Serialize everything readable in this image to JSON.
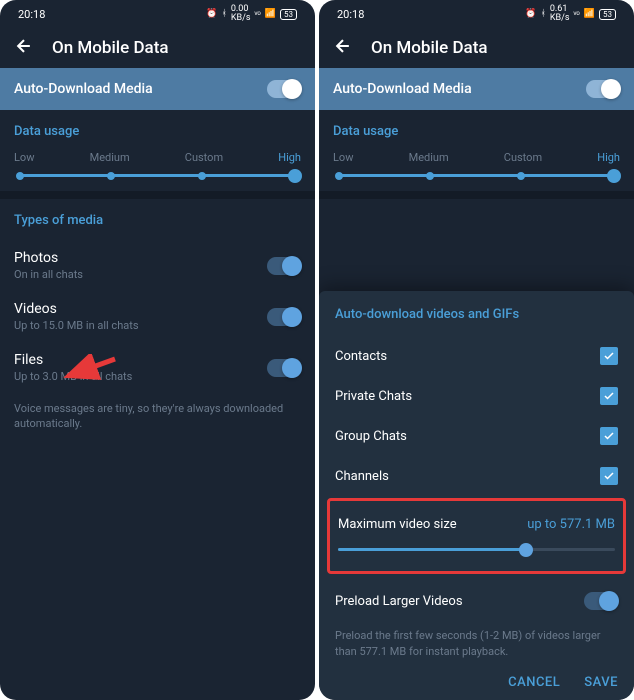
{
  "status": {
    "time": "20:18",
    "battery": "53"
  },
  "header": {
    "title": "On Mobile Data"
  },
  "banner": {
    "title": "Auto-Download Media"
  },
  "dataUsage": {
    "title": "Data usage",
    "labels": [
      "Low",
      "Medium",
      "Custom",
      "High"
    ]
  },
  "media": {
    "title": "Types of media",
    "photos": {
      "title": "Photos",
      "sub": "On in all chats"
    },
    "videos": {
      "title": "Videos",
      "sub": "Up to 15.0 MB in all chats"
    },
    "files": {
      "title": "Files",
      "sub": "Up to 3.0 MB in all chats"
    },
    "note": "Voice messages are tiny, so they're always downloaded automatically."
  },
  "dialog": {
    "title": "Auto-download videos and GIFs",
    "items": [
      "Contacts",
      "Private Chats",
      "Group Chats",
      "Channels"
    ],
    "maxLabel": "Maximum video size",
    "maxValue": "up to 577.1 MB",
    "preload": "Preload Larger Videos",
    "preloadNote": "Preload the first few seconds (1-2 MB) of videos larger than 577.1 MB for instant playback.",
    "cancel": "CANCEL",
    "save": "SAVE"
  }
}
